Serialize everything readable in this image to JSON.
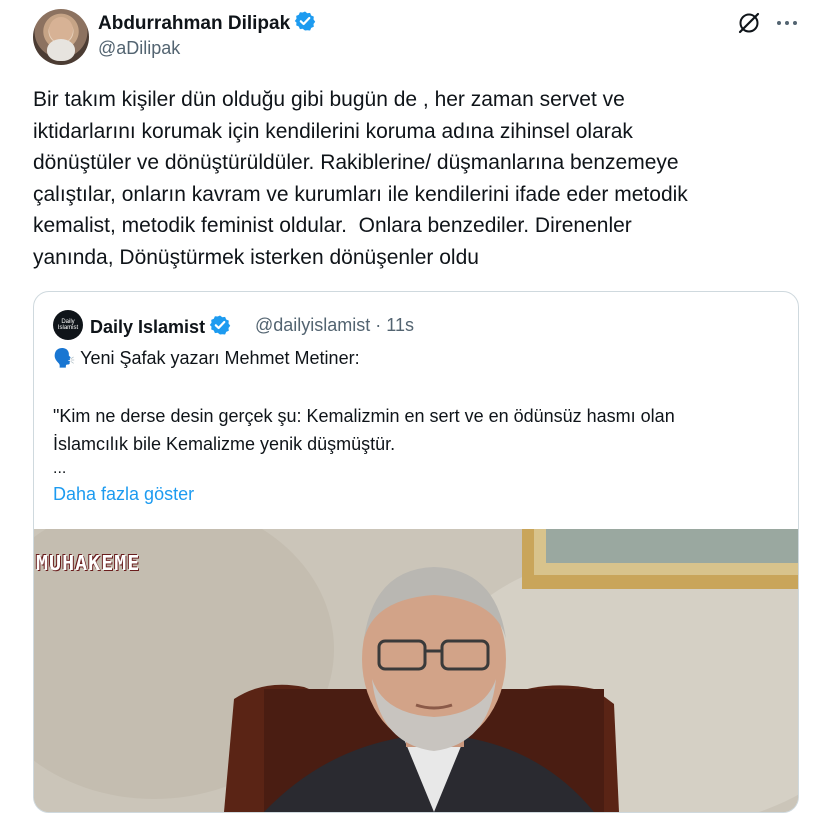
{
  "author": {
    "name": "Abdurrahman Dilipak",
    "handle": "@aDilipak"
  },
  "icons": {
    "verified": "verified-badge-icon",
    "grok": "grok-icon",
    "more": "more-options-icon"
  },
  "tweet": {
    "text": "Bir takım kişiler dün olduğu gibi bugün de , her zaman servet ve\niktidarlarını korumak için kendilerini koruma adına zihinsel olarak\ndönüştüler ve dönüştürüldüler. Rakiblerine/ düşmanlarına benzemeye\nçalıştılar, onların kavram ve kurumları ile kendilerini ifade eder metodik\nkemalist, metodik feminist oldular.  Onlara benzediler. Direnenler\nyanında, Dönüştürmek isterken dönüşenler oldu"
  },
  "quote": {
    "avatar_text": "Daily Islamist",
    "name": "Daily Islamist",
    "handle_time": "@dailyislamist · 11s",
    "line1_emoji": "🗣️",
    "line1": "Yeni Şafak yazarı Mehmet Metiner:",
    "line2": "\"Kim ne derse desin gerçek şu: Kemalizmin en sert ve en ödünsüz hasmı olan\nİslamcılık bile Kemalizme yenik düşmüştür.",
    "ellipsis": "...",
    "show_more": "Daha fazla göster",
    "photo_watermark": "MUHAKEME"
  },
  "colors": {
    "link": "#1d9bf0",
    "secondary_text": "#536471",
    "border": "#cfd9de",
    "verified": "#1d9bf0"
  }
}
